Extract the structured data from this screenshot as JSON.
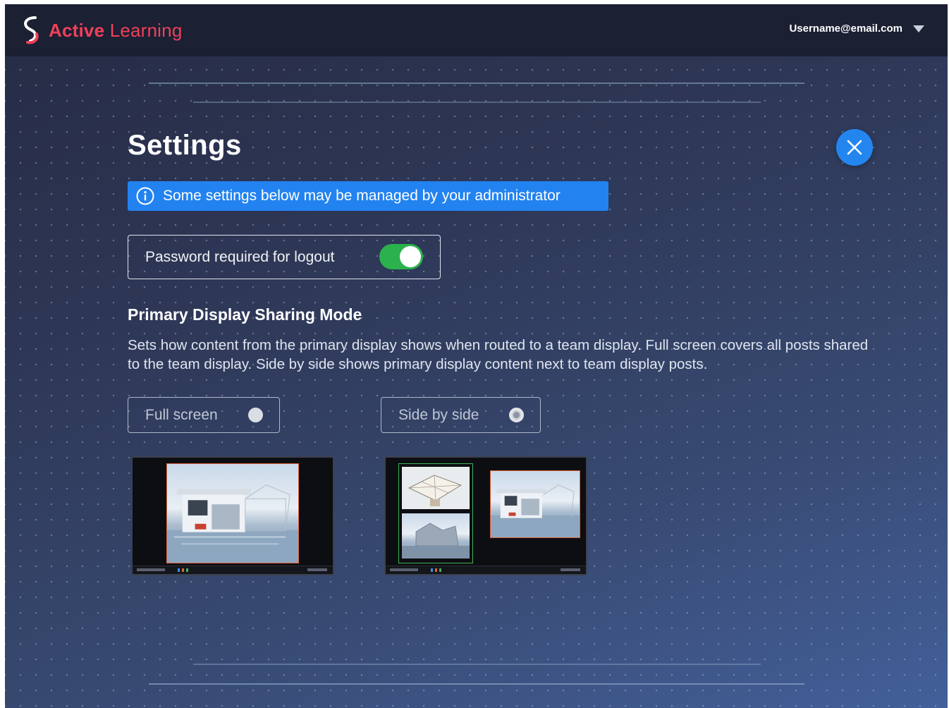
{
  "header": {
    "brand_bold": "Active",
    "brand_light": "Learning",
    "username": "Username@email.com"
  },
  "page": {
    "title": "Settings"
  },
  "notice": {
    "text": "Some settings below may be managed by your administrator"
  },
  "password_setting": {
    "label": "Password required for logout",
    "enabled": true
  },
  "sharing_mode": {
    "title": "Primary Display Sharing Mode",
    "description": "Sets how content from the primary display shows when routed to a team display. Full screen covers all posts shared to the team display. Side by side shows primary display content next to team display posts.",
    "options": [
      {
        "label": "Full screen",
        "selected": false
      },
      {
        "label": "Side by side",
        "selected": true
      }
    ]
  },
  "colors": {
    "brand": "#f0405a",
    "accent": "#2386ef",
    "toggle_on": "#2bb24c"
  },
  "icons": [
    "logo-icon",
    "chevron-down-icon",
    "close-icon",
    "info-icon"
  ]
}
